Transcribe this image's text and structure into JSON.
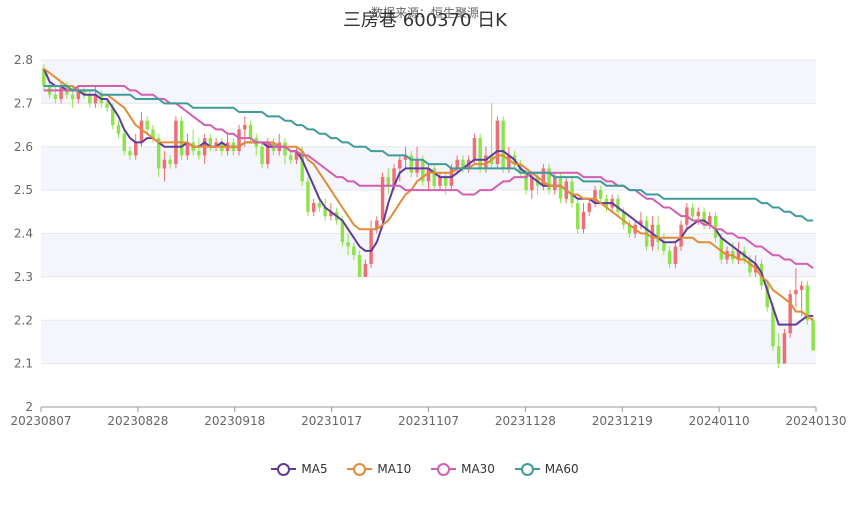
{
  "chart_data": {
    "type": "candlestick",
    "title": "三房巷 600370    日K",
    "subtitle": "数据来源：恒生聚源",
    "x_tick_labels": [
      "20230807",
      "20230828",
      "20230918",
      "20231017",
      "20231107",
      "20231128",
      "20231219",
      "20240110",
      "20240130"
    ],
    "ylim": [
      2.0,
      2.8
    ],
    "y_ticks": [
      2,
      2.1,
      2.2,
      2.3,
      2.4,
      2.5,
      2.6,
      2.7,
      2.8
    ],
    "grid": true,
    "legend_position": "bottom",
    "series": [
      {
        "name": "MA5",
        "color": "#5e3c99"
      },
      {
        "name": "MA10",
        "color": "#e08c3a"
      },
      {
        "name": "MA30",
        "color": "#d45fb0"
      },
      {
        "name": "MA60",
        "color": "#3f9c9a"
      }
    ],
    "up_color": "#f06d73",
    "down_color": "#8fe34a",
    "candles": [
      [
        2.78,
        2.74,
        2.79,
        2.73
      ],
      [
        2.74,
        2.72,
        2.75,
        2.71
      ],
      [
        2.72,
        2.71,
        2.74,
        2.7
      ],
      [
        2.71,
        2.74,
        2.75,
        2.7
      ],
      [
        2.74,
        2.72,
        2.75,
        2.71
      ],
      [
        2.72,
        2.71,
        2.74,
        2.69
      ],
      [
        2.71,
        2.73,
        2.74,
        2.7
      ],
      [
        2.73,
        2.72,
        2.74,
        2.71
      ],
      [
        2.72,
        2.7,
        2.73,
        2.69
      ],
      [
        2.7,
        2.72,
        2.74,
        2.69
      ],
      [
        2.72,
        2.7,
        2.73,
        2.69
      ],
      [
        2.7,
        2.69,
        2.71,
        2.68
      ],
      [
        2.69,
        2.65,
        2.7,
        2.64
      ],
      [
        2.65,
        2.63,
        2.66,
        2.62
      ],
      [
        2.63,
        2.59,
        2.64,
        2.58
      ],
      [
        2.59,
        2.58,
        2.6,
        2.57
      ],
      [
        2.58,
        2.61,
        2.63,
        2.57
      ],
      [
        2.61,
        2.66,
        2.68,
        2.6
      ],
      [
        2.66,
        2.64,
        2.67,
        2.63
      ],
      [
        2.64,
        2.62,
        2.65,
        2.61
      ],
      [
        2.62,
        2.55,
        2.63,
        2.53
      ],
      [
        2.55,
        2.57,
        2.59,
        2.52
      ],
      [
        2.57,
        2.56,
        2.58,
        2.55
      ],
      [
        2.56,
        2.66,
        2.67,
        2.55
      ],
      [
        2.66,
        2.58,
        2.67,
        2.57
      ],
      [
        2.58,
        2.61,
        2.63,
        2.57
      ],
      [
        2.61,
        2.59,
        2.64,
        2.58
      ],
      [
        2.59,
        2.58,
        2.62,
        2.57
      ],
      [
        2.58,
        2.62,
        2.63,
        2.56
      ],
      [
        2.62,
        2.6,
        2.63,
        2.59
      ],
      [
        2.6,
        2.61,
        2.62,
        2.59
      ],
      [
        2.61,
        2.59,
        2.62,
        2.58
      ],
      [
        2.59,
        2.61,
        2.63,
        2.58
      ],
      [
        2.61,
        2.59,
        2.62,
        2.58
      ],
      [
        2.59,
        2.64,
        2.65,
        2.58
      ],
      [
        2.64,
        2.65,
        2.67,
        2.6
      ],
      [
        2.65,
        2.62,
        2.66,
        2.61
      ],
      [
        2.62,
        2.6,
        2.63,
        2.58
      ],
      [
        2.6,
        2.56,
        2.61,
        2.55
      ],
      [
        2.56,
        2.61,
        2.62,
        2.55
      ],
      [
        2.61,
        2.59,
        2.62,
        2.58
      ],
      [
        2.59,
        2.61,
        2.63,
        2.58
      ],
      [
        2.61,
        2.58,
        2.62,
        2.56
      ],
      [
        2.58,
        2.57,
        2.59,
        2.56
      ],
      [
        2.57,
        2.59,
        2.6,
        2.56
      ],
      [
        2.59,
        2.52,
        2.6,
        2.51
      ],
      [
        2.52,
        2.45,
        2.53,
        2.44
      ],
      [
        2.45,
        2.47,
        2.48,
        2.44
      ],
      [
        2.47,
        2.46,
        2.48,
        2.45
      ],
      [
        2.46,
        2.44,
        2.48,
        2.43
      ],
      [
        2.44,
        2.45,
        2.47,
        2.43
      ],
      [
        2.45,
        2.43,
        2.46,
        2.42
      ],
      [
        2.43,
        2.38,
        2.44,
        2.37
      ],
      [
        2.38,
        2.37,
        2.4,
        2.35
      ],
      [
        2.37,
        2.35,
        2.38,
        2.34
      ],
      [
        2.35,
        2.3,
        2.36,
        2.3
      ],
      [
        2.3,
        2.33,
        2.34,
        2.3
      ],
      [
        2.33,
        2.41,
        2.43,
        2.32
      ],
      [
        2.41,
        2.43,
        2.44,
        2.4
      ],
      [
        2.43,
        2.53,
        2.54,
        2.42
      ],
      [
        2.53,
        2.51,
        2.55,
        2.49
      ],
      [
        2.51,
        2.55,
        2.56,
        2.5
      ],
      [
        2.55,
        2.57,
        2.58,
        2.52
      ],
      [
        2.57,
        2.58,
        2.6,
        2.55
      ],
      [
        2.58,
        2.54,
        2.59,
        2.53
      ],
      [
        2.54,
        2.57,
        2.6,
        2.53
      ],
      [
        2.57,
        2.52,
        2.58,
        2.51
      ],
      [
        2.52,
        2.55,
        2.56,
        2.5
      ],
      [
        2.55,
        2.51,
        2.56,
        2.5
      ],
      [
        2.51,
        2.53,
        2.54,
        2.5
      ],
      [
        2.53,
        2.51,
        2.54,
        2.49
      ],
      [
        2.51,
        2.55,
        2.56,
        2.5
      ],
      [
        2.55,
        2.57,
        2.58,
        2.54
      ],
      [
        2.57,
        2.55,
        2.58,
        2.54
      ],
      [
        2.55,
        2.57,
        2.58,
        2.54
      ],
      [
        2.57,
        2.62,
        2.63,
        2.56
      ],
      [
        2.62,
        2.55,
        2.63,
        2.54
      ],
      [
        2.55,
        2.58,
        2.6,
        2.54
      ],
      [
        2.58,
        2.56,
        2.7,
        2.55
      ],
      [
        2.56,
        2.66,
        2.67,
        2.55
      ],
      [
        2.66,
        2.55,
        2.67,
        2.54
      ],
      [
        2.55,
        2.58,
        2.6,
        2.54
      ],
      [
        2.58,
        2.56,
        2.59,
        2.55
      ],
      [
        2.56,
        2.54,
        2.57,
        2.53
      ],
      [
        2.54,
        2.5,
        2.55,
        2.49
      ],
      [
        2.5,
        2.53,
        2.54,
        2.48
      ],
      [
        2.53,
        2.51,
        2.54,
        2.49
      ],
      [
        2.51,
        2.55,
        2.56,
        2.5
      ],
      [
        2.55,
        2.5,
        2.56,
        2.49
      ],
      [
        2.5,
        2.53,
        2.54,
        2.49
      ],
      [
        2.53,
        2.48,
        2.54,
        2.47
      ],
      [
        2.48,
        2.52,
        2.53,
        2.47
      ],
      [
        2.52,
        2.47,
        2.53,
        2.46
      ],
      [
        2.47,
        2.41,
        2.48,
        2.4
      ],
      [
        2.41,
        2.45,
        2.47,
        2.4
      ],
      [
        2.45,
        2.47,
        2.48,
        2.44
      ],
      [
        2.47,
        2.5,
        2.51,
        2.46
      ],
      [
        2.5,
        2.48,
        2.51,
        2.47
      ],
      [
        2.48,
        2.46,
        2.49,
        2.45
      ],
      [
        2.46,
        2.48,
        2.49,
        2.45
      ],
      [
        2.48,
        2.45,
        2.49,
        2.44
      ],
      [
        2.45,
        2.42,
        2.46,
        2.41
      ],
      [
        2.42,
        2.4,
        2.43,
        2.39
      ],
      [
        2.4,
        2.42,
        2.43,
        2.39
      ],
      [
        2.42,
        2.43,
        2.45,
        2.41
      ],
      [
        2.43,
        2.37,
        2.44,
        2.36
      ],
      [
        2.37,
        2.42,
        2.44,
        2.36
      ],
      [
        2.42,
        2.38,
        2.44,
        2.36
      ],
      [
        2.38,
        2.36,
        2.4,
        2.35
      ],
      [
        2.36,
        2.33,
        2.37,
        2.32
      ],
      [
        2.33,
        2.37,
        2.38,
        2.32
      ],
      [
        2.37,
        2.42,
        2.43,
        2.36
      ],
      [
        2.42,
        2.46,
        2.47,
        2.41
      ],
      [
        2.46,
        2.44,
        2.47,
        2.43
      ],
      [
        2.44,
        2.45,
        2.46,
        2.42
      ],
      [
        2.45,
        2.42,
        2.46,
        2.41
      ],
      [
        2.42,
        2.44,
        2.45,
        2.41
      ],
      [
        2.44,
        2.39,
        2.45,
        2.38
      ],
      [
        2.39,
        2.34,
        2.4,
        2.33
      ],
      [
        2.34,
        2.36,
        2.37,
        2.33
      ],
      [
        2.36,
        2.34,
        2.38,
        2.33
      ],
      [
        2.34,
        2.36,
        2.38,
        2.33
      ],
      [
        2.36,
        2.34,
        2.37,
        2.33
      ],
      [
        2.34,
        2.31,
        2.35,
        2.3
      ],
      [
        2.31,
        2.33,
        2.35,
        2.3
      ],
      [
        2.33,
        2.28,
        2.34,
        2.27
      ],
      [
        2.28,
        2.23,
        2.29,
        2.22
      ],
      [
        2.23,
        2.14,
        2.24,
        2.13
      ],
      [
        2.14,
        2.1,
        2.17,
        2.09
      ],
      [
        2.1,
        2.17,
        2.18,
        2.1
      ],
      [
        2.17,
        2.26,
        2.27,
        2.16
      ],
      [
        2.26,
        2.27,
        2.32,
        2.23
      ],
      [
        2.27,
        2.28,
        2.29,
        2.21
      ],
      [
        2.28,
        2.2,
        2.29,
        2.19
      ],
      [
        2.2,
        2.13,
        2.21,
        2.13
      ]
    ],
    "ma5": [
      2.78,
      2.75,
      2.74,
      2.74,
      2.73,
      2.73,
      2.73,
      2.72,
      2.72,
      2.72,
      2.71,
      2.71,
      2.69,
      2.67,
      2.64,
      2.62,
      2.61,
      2.61,
      2.62,
      2.62,
      2.61,
      2.6,
      2.6,
      2.6,
      2.6,
      2.61,
      2.6,
      2.6,
      2.61,
      2.6,
      2.6,
      2.61,
      2.6,
      2.6,
      2.6,
      2.61,
      2.61,
      2.61,
      2.61,
      2.6,
      2.6,
      2.6,
      2.6,
      2.59,
      2.59,
      2.57,
      2.54,
      2.51,
      2.48,
      2.46,
      2.45,
      2.44,
      2.43,
      2.41,
      2.39,
      2.37,
      2.36,
      2.36,
      2.38,
      2.42,
      2.47,
      2.51,
      2.54,
      2.55,
      2.55,
      2.55,
      2.55,
      2.55,
      2.54,
      2.53,
      2.53,
      2.53,
      2.54,
      2.55,
      2.56,
      2.57,
      2.57,
      2.57,
      2.58,
      2.59,
      2.59,
      2.58,
      2.57,
      2.55,
      2.54,
      2.53,
      2.52,
      2.51,
      2.51,
      2.51,
      2.51,
      2.5,
      2.49,
      2.48,
      2.48,
      2.48,
      2.47,
      2.47,
      2.47,
      2.47,
      2.46,
      2.45,
      2.44,
      2.43,
      2.42,
      2.41,
      2.4,
      2.39,
      2.38,
      2.38,
      2.38,
      2.39,
      2.41,
      2.42,
      2.43,
      2.43,
      2.42,
      2.41,
      2.39,
      2.38,
      2.37,
      2.36,
      2.35,
      2.34,
      2.33,
      2.31,
      2.27,
      2.23,
      2.19,
      2.19,
      2.19,
      2.19,
      2.2,
      2.21,
      2.21
    ],
    "ma10": [
      2.78,
      2.77,
      2.76,
      2.75,
      2.74,
      2.74,
      2.73,
      2.73,
      2.73,
      2.73,
      2.72,
      2.72,
      2.71,
      2.7,
      2.69,
      2.67,
      2.65,
      2.64,
      2.63,
      2.62,
      2.61,
      2.61,
      2.61,
      2.61,
      2.61,
      2.61,
      2.6,
      2.6,
      2.6,
      2.6,
      2.6,
      2.6,
      2.6,
      2.6,
      2.6,
      2.61,
      2.61,
      2.61,
      2.61,
      2.61,
      2.61,
      2.6,
      2.6,
      2.6,
      2.6,
      2.59,
      2.57,
      2.56,
      2.54,
      2.52,
      2.5,
      2.48,
      2.46,
      2.44,
      2.42,
      2.41,
      2.41,
      2.41,
      2.41,
      2.42,
      2.43,
      2.45,
      2.47,
      2.49,
      2.5,
      2.52,
      2.53,
      2.54,
      2.54,
      2.54,
      2.54,
      2.54,
      2.55,
      2.55,
      2.55,
      2.56,
      2.56,
      2.56,
      2.57,
      2.58,
      2.58,
      2.57,
      2.56,
      2.56,
      2.55,
      2.54,
      2.53,
      2.52,
      2.51,
      2.51,
      2.51,
      2.5,
      2.49,
      2.49,
      2.48,
      2.48,
      2.48,
      2.47,
      2.46,
      2.45,
      2.44,
      2.43,
      2.42,
      2.41,
      2.4,
      2.4,
      2.39,
      2.39,
      2.39,
      2.39,
      2.39,
      2.39,
      2.39,
      2.39,
      2.38,
      2.38,
      2.38,
      2.37,
      2.36,
      2.35,
      2.35,
      2.34,
      2.34,
      2.33,
      2.32,
      2.3,
      2.29,
      2.27,
      2.26,
      2.25,
      2.24,
      2.22,
      2.22,
      2.21,
      2.2
    ],
    "ma30": [
      2.73,
      2.73,
      2.73,
      2.73,
      2.73,
      2.73,
      2.74,
      2.74,
      2.74,
      2.74,
      2.74,
      2.74,
      2.74,
      2.74,
      2.74,
      2.73,
      2.73,
      2.72,
      2.72,
      2.72,
      2.71,
      2.71,
      2.7,
      2.7,
      2.69,
      2.68,
      2.67,
      2.66,
      2.65,
      2.65,
      2.64,
      2.64,
      2.63,
      2.63,
      2.62,
      2.62,
      2.62,
      2.61,
      2.61,
      2.61,
      2.6,
      2.6,
      2.6,
      2.59,
      2.59,
      2.58,
      2.58,
      2.57,
      2.56,
      2.55,
      2.54,
      2.53,
      2.53,
      2.52,
      2.52,
      2.51,
      2.51,
      2.51,
      2.51,
      2.51,
      2.51,
      2.51,
      2.51,
      2.5,
      2.5,
      2.5,
      2.5,
      2.5,
      2.5,
      2.5,
      2.5,
      2.5,
      2.5,
      2.49,
      2.49,
      2.49,
      2.5,
      2.5,
      2.5,
      2.51,
      2.52,
      2.52,
      2.53,
      2.53,
      2.53,
      2.54,
      2.54,
      2.54,
      2.54,
      2.54,
      2.54,
      2.54,
      2.54,
      2.54,
      2.53,
      2.53,
      2.53,
      2.53,
      2.52,
      2.52,
      2.51,
      2.51,
      2.5,
      2.5,
      2.49,
      2.48,
      2.48,
      2.47,
      2.46,
      2.46,
      2.45,
      2.44,
      2.44,
      2.43,
      2.43,
      2.42,
      2.42,
      2.41,
      2.41,
      2.4,
      2.4,
      2.39,
      2.39,
      2.38,
      2.37,
      2.37,
      2.36,
      2.35,
      2.35,
      2.34,
      2.34,
      2.33,
      2.33,
      2.33,
      2.32
    ],
    "ma60": [
      2.74,
      2.74,
      2.74,
      2.74,
      2.74,
      2.73,
      2.73,
      2.73,
      2.73,
      2.73,
      2.72,
      2.72,
      2.72,
      2.72,
      2.72,
      2.72,
      2.71,
      2.71,
      2.71,
      2.71,
      2.71,
      2.7,
      2.7,
      2.7,
      2.7,
      2.7,
      2.69,
      2.69,
      2.69,
      2.69,
      2.69,
      2.69,
      2.69,
      2.69,
      2.68,
      2.68,
      2.68,
      2.68,
      2.68,
      2.67,
      2.67,
      2.67,
      2.66,
      2.66,
      2.65,
      2.65,
      2.64,
      2.64,
      2.63,
      2.63,
      2.62,
      2.62,
      2.61,
      2.61,
      2.6,
      2.6,
      2.6,
      2.59,
      2.59,
      2.59,
      2.58,
      2.58,
      2.58,
      2.58,
      2.57,
      2.57,
      2.57,
      2.56,
      2.56,
      2.56,
      2.56,
      2.55,
      2.55,
      2.55,
      2.55,
      2.55,
      2.55,
      2.55,
      2.55,
      2.55,
      2.55,
      2.55,
      2.55,
      2.54,
      2.54,
      2.54,
      2.54,
      2.54,
      2.54,
      2.53,
      2.53,
      2.53,
      2.53,
      2.53,
      2.52,
      2.52,
      2.52,
      2.52,
      2.51,
      2.51,
      2.51,
      2.51,
      2.5,
      2.5,
      2.5,
      2.49,
      2.49,
      2.49,
      2.48,
      2.48,
      2.48,
      2.48,
      2.48,
      2.48,
      2.48,
      2.48,
      2.48,
      2.48,
      2.48,
      2.48,
      2.48,
      2.48,
      2.48,
      2.48,
      2.48,
      2.47,
      2.47,
      2.46,
      2.46,
      2.45,
      2.45,
      2.44,
      2.44,
      2.43,
      2.43
    ]
  }
}
